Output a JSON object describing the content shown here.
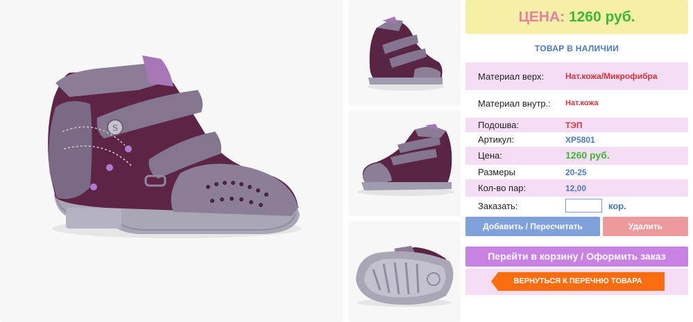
{
  "product": {
    "price_label": "ЦЕНА:",
    "price_value": "1260 руб.",
    "stock_status": "ТОВАР В НАЛИЧИИ"
  },
  "specs": {
    "material_top_label": "Материал верх:",
    "material_top_value": "Нат.кожа/Микрофибра",
    "material_inner_label": "Материал внутр.:",
    "material_inner_value": "Нат.кожа",
    "sole_label": "Подошва:",
    "sole_value": "ТЭП",
    "article_label": "Артикул:",
    "article_value": "ХР5801",
    "price_label": "Цена:",
    "price_value": "1260 руб.",
    "sizes_label": "Размеры",
    "sizes_value": "20-25",
    "pairs_label": "Кол-во пар:",
    "pairs_value": "12,00",
    "order_label": "Заказать:",
    "order_value": "",
    "order_unit": "кор."
  },
  "actions": {
    "add_label": "Добавить / Пересчитать",
    "delete_label": "Удалить",
    "cart_label": "Перейти в корзину / Оформить заказ",
    "back_label": "ВЕРНУТЬСЯ К ПЕРЕЧНЮ ТОВАРА"
  },
  "colors": {
    "price_box_bg": "#f6f0a6",
    "price_label": "#e77fa5",
    "price_value": "#3db836",
    "row_highlight": "#f6ddf6",
    "add_button": "#7fa2dc",
    "delete_button": "#ee9a9c",
    "cart_button": "#c882e4",
    "back_button": "#fc6d10"
  }
}
